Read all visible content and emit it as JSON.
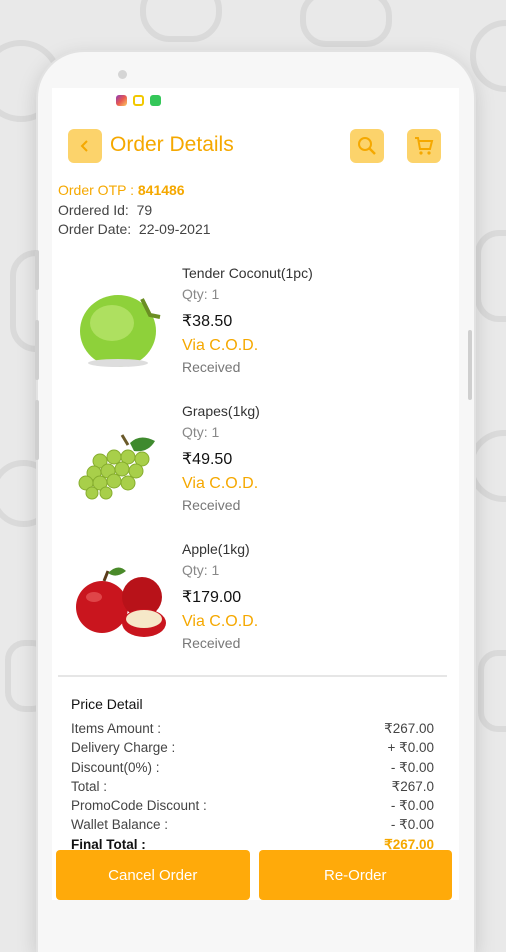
{
  "header": {
    "title": "Order Details",
    "back_icon": "chevron-left-icon",
    "search_icon": "search-icon",
    "cart_icon": "cart-icon",
    "accent_color": "#f5a800"
  },
  "order": {
    "otp_label": "Order OTP :",
    "otp_value": "841486",
    "id_label": "Ordered Id:",
    "id_value": "79",
    "date_label": "Order Date:",
    "date_value": "22-09-2021"
  },
  "items": [
    {
      "name": "Tender Coconut(1pc)",
      "qty": "Qty:  1",
      "price": "₹38.50",
      "payment": "Via C.O.D.",
      "status": "Received",
      "image": "coconut"
    },
    {
      "name": "Grapes(1kg)",
      "qty": "Qty:  1",
      "price": "₹49.50",
      "payment": "Via C.O.D.",
      "status": "Received",
      "image": "grapes"
    },
    {
      "name": "Apple(1kg)",
      "qty": "Qty:  1",
      "price": "₹179.00",
      "payment": "Via C.O.D.",
      "status": "Received",
      "image": "apples"
    }
  ],
  "price_detail": {
    "title": "Price Detail",
    "rows": [
      {
        "label": "Items Amount :",
        "value": "₹267.00"
      },
      {
        "label": "Delivery Charge :",
        "value": "+ ₹0.00"
      },
      {
        "label": "Discount(0%) :",
        "value": "- ₹0.00"
      },
      {
        "label": "Total :",
        "value": "₹267.0"
      },
      {
        "label": "PromoCode Discount :",
        "value": "- ₹0.00"
      },
      {
        "label": "Wallet Balance :",
        "value": "- ₹0.00"
      },
      {
        "label": "Final Total :",
        "value": "₹267.00"
      }
    ]
  },
  "actions": {
    "cancel_label": "Cancel Order",
    "reorder_label": "Re-Order",
    "button_color": "#ffaa0a"
  }
}
